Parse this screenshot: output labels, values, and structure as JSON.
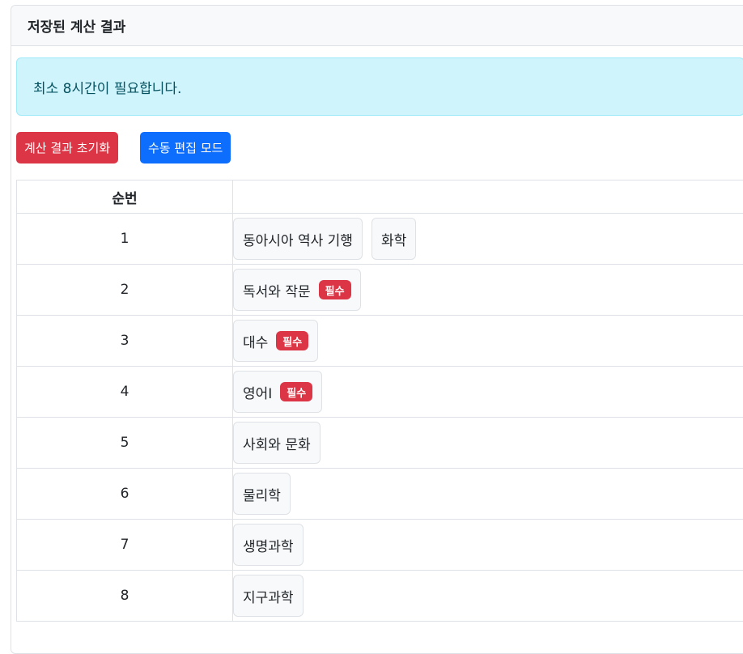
{
  "card": {
    "title": "저장된 계산 결과"
  },
  "alert": {
    "message": "최소 8시간이 필요합니다."
  },
  "buttons": {
    "reset": "계산 결과 초기화",
    "edit": "수동 편집 모드"
  },
  "table": {
    "headers": [
      "순번",
      ""
    ],
    "required_label": "필수",
    "rows": [
      {
        "num": "1",
        "subjects": [
          {
            "name": "동아시아 역사 기행",
            "required": false
          },
          {
            "name": "화학",
            "required": false
          }
        ]
      },
      {
        "num": "2",
        "subjects": [
          {
            "name": "독서와 작문",
            "required": true
          }
        ]
      },
      {
        "num": "3",
        "subjects": [
          {
            "name": "대수",
            "required": true
          }
        ]
      },
      {
        "num": "4",
        "subjects": [
          {
            "name": "영어I",
            "required": true
          }
        ]
      },
      {
        "num": "5",
        "subjects": [
          {
            "name": "사회와 문화",
            "required": false
          }
        ]
      },
      {
        "num": "6",
        "subjects": [
          {
            "name": "물리학",
            "required": false
          }
        ]
      },
      {
        "num": "7",
        "subjects": [
          {
            "name": "생명과학",
            "required": false
          }
        ]
      },
      {
        "num": "8",
        "subjects": [
          {
            "name": "지구과학",
            "required": false
          }
        ]
      }
    ]
  },
  "colors": {
    "danger": "#dc3545",
    "primary": "#0d6efd",
    "info_bg": "#cff4fc",
    "info_text": "#055160",
    "border": "#dee2e6"
  }
}
